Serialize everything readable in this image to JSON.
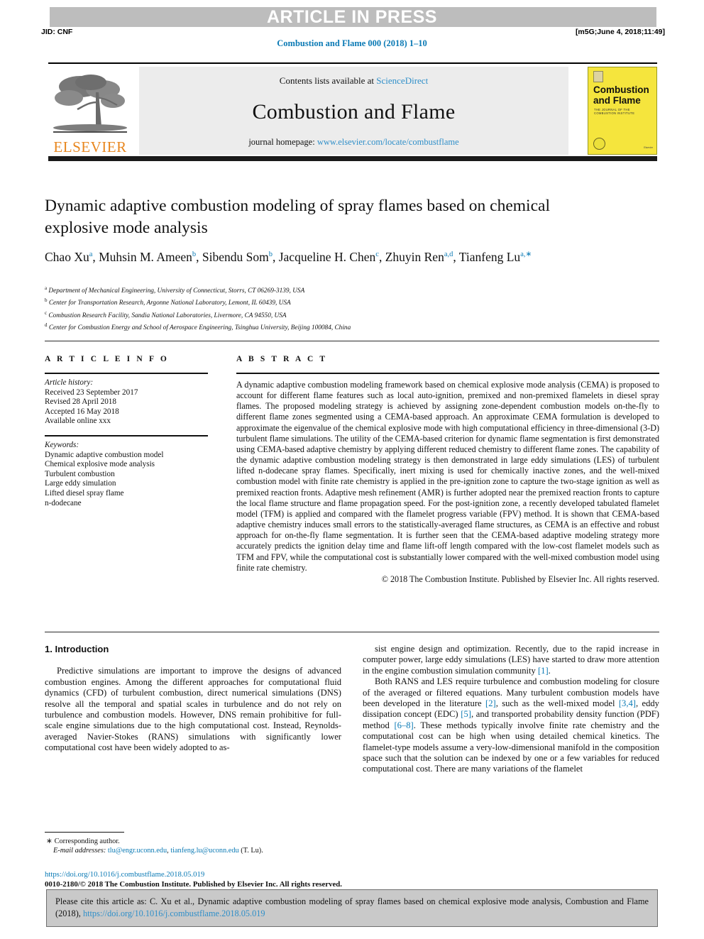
{
  "header": {
    "banner_text": "ARTICLE IN PRESS",
    "jid": "JID: CNF",
    "stamp": "[m5G;June 4, 2018;11:49]",
    "journal_ref": "Combustion and Flame 000 (2018) 1–10"
  },
  "masthead": {
    "contents_prefix": "Contents lists available at ",
    "contents_link": "ScienceDirect",
    "journal_name": "Combustion and Flame",
    "homepage_prefix": "journal homepage: ",
    "homepage_link": "www.elsevier.com/locate/combustflame",
    "publisher_logo_text": "ELSEVIER",
    "cover_title_line1": "Combustion",
    "cover_title_line2": "and Flame",
    "cover_subtitle": "THE JOURNAL OF THE COMBUSTION INSTITUTE",
    "cover_footer": "Elsevier"
  },
  "article": {
    "title": "Dynamic adaptive combustion modeling of spray flames based on chemical explosive mode analysis",
    "authors_html": "Chao Xu<sup>a</sup>, Muhsin M. Ameen<sup>b</sup>, Sibendu Som<sup>b</sup>, Jacqueline H. Chen<sup>c</sup>, Zhuyin Ren<sup>a,d</sup>, Tianfeng Lu<sup>a,&#8727;</sup>",
    "affiliations": [
      {
        "marker": "a",
        "text": "Department of Mechanical Engineering, University of Connecticut, Storrs, CT 06269-3139, USA"
      },
      {
        "marker": "b",
        "text": "Center for Transportation Research, Argonne National Laboratory, Lemont, IL 60439, USA"
      },
      {
        "marker": "c",
        "text": "Combustion Research Facility, Sandia National Laboratories, Livermore, CA 94550, USA"
      },
      {
        "marker": "d",
        "text": "Center for Combustion Energy and School of Aerospace Engineering, Tsinghua University, Beijing 100084, China"
      }
    ]
  },
  "article_info": {
    "heading": "A R T I C L E   I N F O",
    "history_label": "Article history:",
    "history": [
      "Received 23 September 2017",
      "Revised 28 April 2018",
      "Accepted 16 May 2018",
      "Available online xxx"
    ],
    "keywords_label": "Keywords:",
    "keywords": [
      "Dynamic adaptive combustion model",
      "Chemical explosive mode analysis",
      "Turbulent combustion",
      "Large eddy simulation",
      "Lifted diesel spray flame",
      "n-dodecane"
    ]
  },
  "abstract": {
    "heading": "A B S T R A C T",
    "text": "A dynamic adaptive combustion modeling framework based on chemical explosive mode analysis (CEMA) is proposed to account for different flame features such as local auto-ignition, premixed and non-premixed flamelets in diesel spray flames. The proposed modeling strategy is achieved by assigning zone-dependent combustion models on-the-fly to different flame zones segmented using a CEMA-based approach. An approximate CEMA formulation is developed to approximate the eigenvalue of the chemical explosive mode with high computational efficiency in three-dimensional (3-D) turbulent flame simulations. The utility of the CEMA-based criterion for dynamic flame segmentation is first demonstrated using CEMA-based adaptive chemistry by applying different reduced chemistry to different flame zones. The capability of the dynamic adaptive combustion modeling strategy is then demonstrated in large eddy simulations (LES) of turbulent lifted n-dodecane spray flames. Specifically, inert mixing is used for chemically inactive zones, and the well-mixed combustion model with finite rate chemistry is applied in the pre-ignition zone to capture the two-stage ignition as well as premixed reaction fronts. Adaptive mesh refinement (AMR) is further adopted near the premixed reaction fronts to capture the local flame structure and flame propagation speed. For the post-ignition zone, a recently developed tabulated flamelet model (TFM) is applied and compared with the flamelet progress variable (FPV) method. It is shown that CEMA-based adaptive chemistry induces small errors to the statistically-averaged flame structures, as CEMA is an effective and robust approach for on-the-fly flame segmentation. It is further seen that the CEMA-based adaptive modeling strategy more accurately predicts the ignition delay time and flame lift-off length compared with the low-cost flamelet models such as TFM and FPV, while the computational cost is substantially lower compared with the well-mixed combustion model using finite rate chemistry.",
    "copyright": "© 2018 The Combustion Institute. Published by Elsevier Inc. All rights reserved."
  },
  "body": {
    "section_heading": "1. Introduction",
    "left_paragraph": "Predictive simulations are important to improve the designs of advanced combustion engines. Among the different approaches for computational fluid dynamics (CFD) of turbulent combustion, direct numerical simulations (DNS) resolve all the temporal and spatial scales in turbulence and do not rely on turbulence and combustion models. However, DNS remain prohibitive for full-scale engine simulations due to the high computational cost. Instead, Reynolds-averaged Navier-Stokes (RANS) simulations with significantly lower computational cost have been widely adopted to as-",
    "right_paragraph_1_pre": "sist engine design and optimization. Recently, due to the rapid increase in computer power, large eddy simulations (LES) have started to draw more attention in the engine combustion simulation community ",
    "right_paragraph_1_ref": "[1]",
    "right_paragraph_1_post": ".",
    "right_paragraph_2_a": "Both RANS and LES require turbulence and combustion modeling for closure of the averaged or filtered equations. Many turbulent combustion models have been developed in the literature ",
    "right_ref_2": "[2]",
    "right_paragraph_2_b": ", such as the well-mixed model ",
    "right_ref_34": "[3,4]",
    "right_paragraph_2_c": ", eddy dissipation concept (EDC) ",
    "right_ref_5": "[5]",
    "right_paragraph_2_d": ", and transported probability density function (PDF) method ",
    "right_ref_68": "[6–8]",
    "right_paragraph_2_e": ". These methods typically involve finite rate chemistry and the computational cost can be high when using detailed chemical kinetics. The flamelet-type models assume a very-low-dimensional manifold in the composition space such that the solution can be indexed by one or a few variables for reduced computational cost. There are many variations of the flamelet"
  },
  "footnote": {
    "corresponding": "Corresponding author.",
    "email_label": "E-mail addresses:",
    "email_1": "tlu@engr.uconn.edu",
    "email_2": "tianfeng.lu@uconn.edu",
    "email_suffix": "(T. Lu)."
  },
  "publication": {
    "doi": "https://doi.org/10.1016/j.combustflame.2018.05.019",
    "issn_copyright": "0010-2180/© 2018 The Combustion Institute. Published by Elsevier Inc. All rights reserved."
  },
  "cite_box": {
    "text_pre": "Please cite this article as: C. Xu et al., Dynamic adaptive combustion modeling of spray flames based on chemical explosive mode analysis, Combustion and Flame (2018), ",
    "link": "https://doi.org/10.1016/j.combustflame.2018.05.019"
  },
  "colors": {
    "link_blue": "#0b7ab5",
    "link_light_blue": "#2f8fc9",
    "banner_gray": "#bdbdbd",
    "elsevier_orange": "#e8861e",
    "cover_yellow": "#f5e53d"
  }
}
